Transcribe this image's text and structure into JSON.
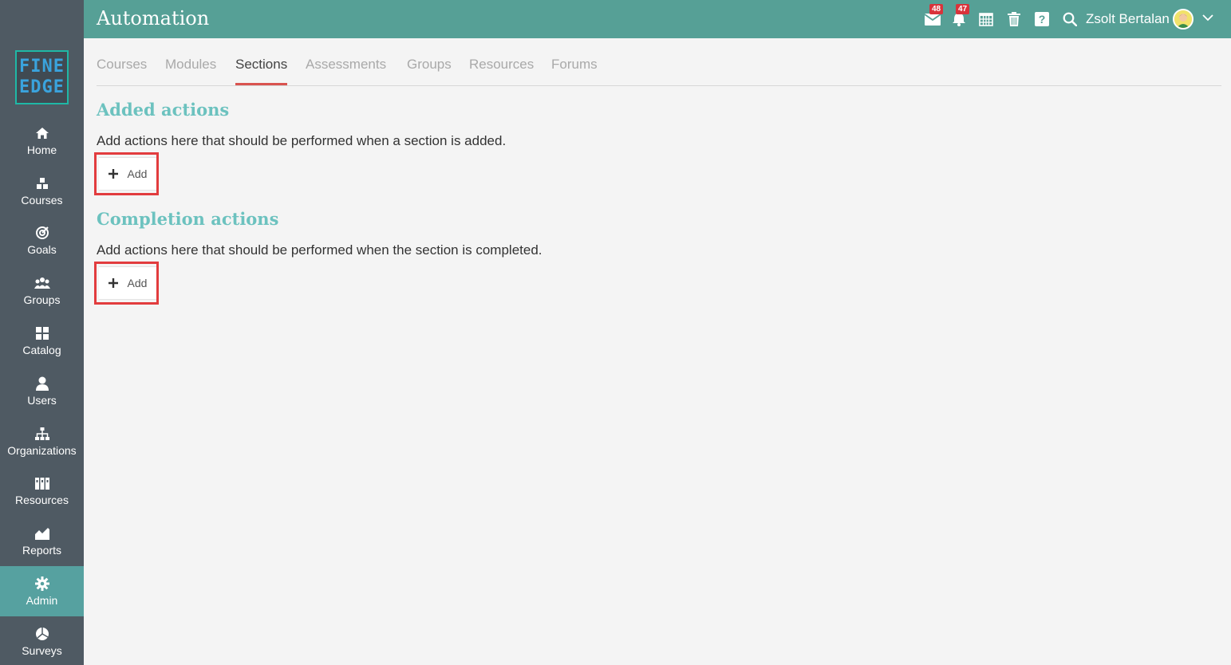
{
  "header": {
    "title": "Automation",
    "messages_badge": "48",
    "notifications_badge": "47",
    "user_name": "Zsolt Bertalan"
  },
  "logo": {
    "line1": "FINE",
    "line2": "EDGE"
  },
  "sidebar": {
    "items": [
      {
        "label": "Home",
        "icon": "home-icon"
      },
      {
        "label": "Courses",
        "icon": "courses-icon"
      },
      {
        "label": "Goals",
        "icon": "target-icon"
      },
      {
        "label": "Groups",
        "icon": "groups-icon"
      },
      {
        "label": "Catalog",
        "icon": "grid-icon"
      },
      {
        "label": "Users",
        "icon": "user-icon"
      },
      {
        "label": "Organizations",
        "icon": "org-chart-icon"
      },
      {
        "label": "Resources",
        "icon": "books-icon"
      },
      {
        "label": "Reports",
        "icon": "chart-icon"
      },
      {
        "label": "Admin",
        "icon": "gear-icon",
        "active": true
      },
      {
        "label": "Surveys",
        "icon": "pie-icon"
      }
    ]
  },
  "tabs": [
    {
      "label": "Courses"
    },
    {
      "label": "Modules"
    },
    {
      "label": "Sections",
      "active": true
    },
    {
      "label": "Assessments"
    },
    {
      "label": "Groups"
    },
    {
      "label": "Resources"
    },
    {
      "label": "Forums"
    }
  ],
  "added_actions": {
    "title": "Added actions",
    "description": "Add actions here that should be performed when a section is added.",
    "button_label": "Add"
  },
  "completion_actions": {
    "title": "Completion actions",
    "description": "Add actions here that should be performed when the section is completed.",
    "button_label": "Add"
  },
  "colors": {
    "header": "#56a096",
    "sidebar": "#4f5a63",
    "active_nav": "#56a1a0",
    "accent_title": "#6cc2bf",
    "tab_underline": "#d9534f",
    "highlight": "#e23c3e"
  }
}
